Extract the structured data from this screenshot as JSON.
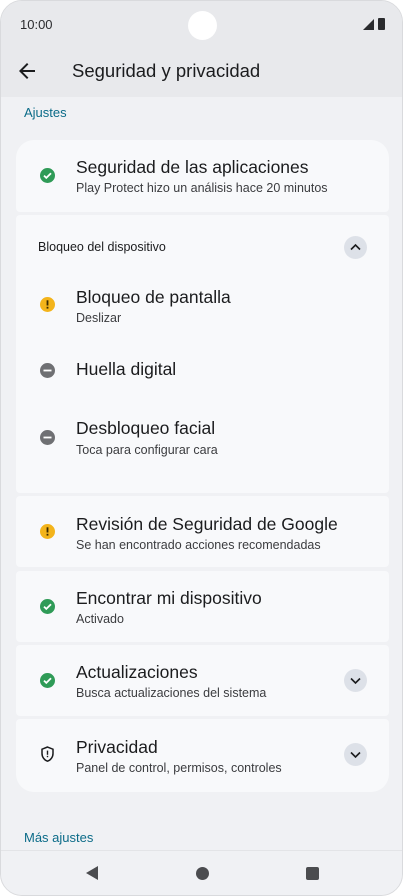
{
  "status_bar": {
    "time": "10:00",
    "icons": [
      "signal-icon",
      "battery-icon"
    ]
  },
  "app_bar": {
    "title": "Seguridad y privacidad",
    "back_icon": "arrow-back-icon"
  },
  "sections": {
    "settings_header": "Ajustes",
    "more_settings_header": "Más ajustes"
  },
  "items": {
    "app_security": {
      "title": "Seguridad de las aplicaciones",
      "subtitle": "Play Protect hizo un análisis hace 20 minutos",
      "status": "ok"
    },
    "device_lock": {
      "group_label": "Bloqueo del dispositivo",
      "expanded": true,
      "screen_lock": {
        "title": "Bloqueo de pantalla",
        "subtitle": "Deslizar",
        "status": "warning"
      },
      "fingerprint": {
        "title": "Huella digital",
        "status": "off"
      },
      "face_unlock": {
        "title": "Desbloqueo facial",
        "subtitle": "Toca para configurar cara",
        "status": "off"
      }
    },
    "google_checkup": {
      "title": "Revisión de Seguridad de Google",
      "subtitle": "Se han encontrado acciones recomendadas",
      "status": "warning"
    },
    "find_device": {
      "title": "Encontrar mi dispositivo",
      "subtitle": "Activado",
      "status": "ok"
    },
    "updates": {
      "title": "Actualizaciones",
      "subtitle": "Busca actualizaciones del sistema",
      "status": "ok",
      "expanded": false
    },
    "privacy": {
      "title": "Privacidad",
      "subtitle": "Panel de control, permisos, controles",
      "icon": "shield-icon",
      "expanded": false
    }
  },
  "colors": {
    "ok": "#2f9b57",
    "warning": "#f3b41b",
    "off": "#6f7073",
    "accent": "#0b6b88"
  },
  "nav_bar": {
    "icons": [
      "nav-back-icon",
      "nav-home-icon",
      "nav-recents-icon"
    ]
  }
}
